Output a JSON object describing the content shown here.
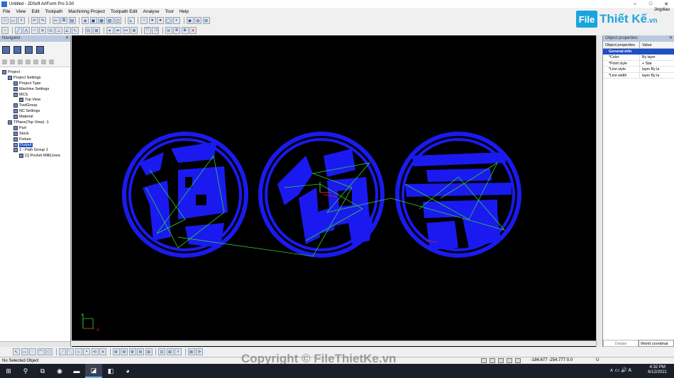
{
  "window": {
    "title": "Untitled - JDSoft ArtForm Pro 3.50",
    "user": "Jingdiao"
  },
  "menu": [
    "File",
    "View",
    "Edit",
    "Toolpath",
    "Machining Project",
    "Toolpath Edit",
    "Analyse",
    "Tool",
    "Help"
  ],
  "logo": {
    "box": "File",
    "text": "Thiết Kế",
    "suffix": ".vn"
  },
  "navigator": {
    "title": "Navigator",
    "tree": [
      {
        "label": "Project",
        "level": 0
      },
      {
        "label": "Project Settings",
        "level": 1
      },
      {
        "label": "Project Type",
        "level": 2
      },
      {
        "label": "Machine Settings",
        "level": 2
      },
      {
        "label": "MCS",
        "level": 2
      },
      {
        "label": "Top View",
        "level": 3
      },
      {
        "label": "ToolGroup",
        "level": 2
      },
      {
        "label": "NC Settings",
        "level": 2
      },
      {
        "label": "Material",
        "level": 2
      },
      {
        "label": "TPlane(Top View) -1",
        "level": 1
      },
      {
        "label": "Part",
        "level": 2
      },
      {
        "label": "Stock",
        "level": 2
      },
      {
        "label": "Fixture",
        "level": 2
      },
      {
        "label": "Output",
        "level": 2,
        "selected": true
      },
      {
        "label": "1 - Path Group 1",
        "level": 2
      },
      {
        "label": "[1] Pocket Mill(Linea",
        "level": 3
      }
    ]
  },
  "properties": {
    "title": "Object properties",
    "col_key": "Object properties",
    "col_value": "Value",
    "group": "General-info",
    "rows": [
      {
        "key": "*Color",
        "value": "By layer"
      },
      {
        "key": "*Point style",
        "value": "+  Star"
      },
      {
        "key": "*Line style",
        "value": "layer  By la"
      },
      {
        "key": "*Line width",
        "value": "layer  By la"
      }
    ],
    "details_label": "Details",
    "coord_select": "World coordinat"
  },
  "axis": {
    "y": "Y",
    "x": "X"
  },
  "status": {
    "message": "No Selected Object",
    "coordinates": "-184.677 -254.777 0.0",
    "unit": "U"
  },
  "watermark": "Copyright © FileThietKe.vn",
  "taskbar": {
    "time": "4:32 PM",
    "date": "6/12/2021"
  },
  "colors": {
    "fill": "#1a1af0",
    "viewport": "#000000",
    "path": "#2fd03a",
    "selection": "#1c4fc9"
  }
}
